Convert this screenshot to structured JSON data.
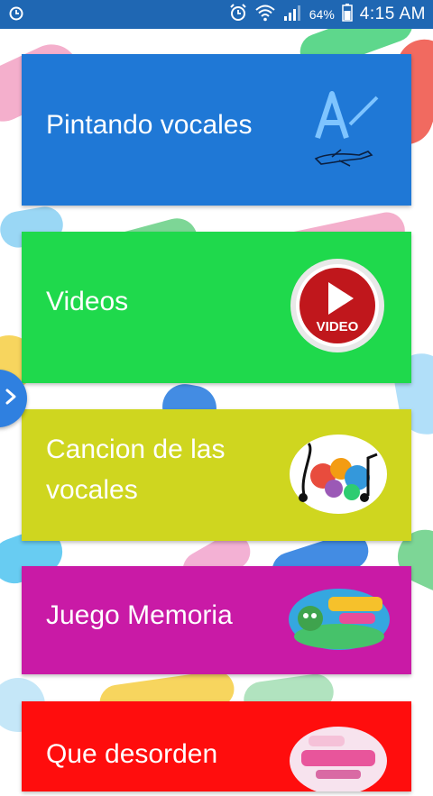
{
  "status_bar": {
    "battery_percent": "64%",
    "time": "4:15 AM",
    "icons": [
      "alarm-icon",
      "alarm-clock-icon",
      "wifi-icon",
      "signal-icon",
      "battery-icon"
    ]
  },
  "menu": {
    "items": [
      {
        "label": "Pintando vocales",
        "color": "#1f78d6",
        "icon": "pencil-letter-a-icon"
      },
      {
        "label": "Videos",
        "color": "#1fd94c",
        "icon": "video-play-icon",
        "icon_text": "VIDEO"
      },
      {
        "label_line1": "Cancion de las",
        "label_line2": "vocales",
        "color": "#cfd61f",
        "icon": "music-notes-icon"
      },
      {
        "label": "Juego Memoria",
        "color": "#c91aa6",
        "icon": "memoria-vocales-logo"
      },
      {
        "label": "Que desorden",
        "color": "#ff0d0d",
        "icon": "que-desorden-logo"
      }
    ]
  },
  "drawer": {
    "icon": "chevron-right-icon"
  }
}
